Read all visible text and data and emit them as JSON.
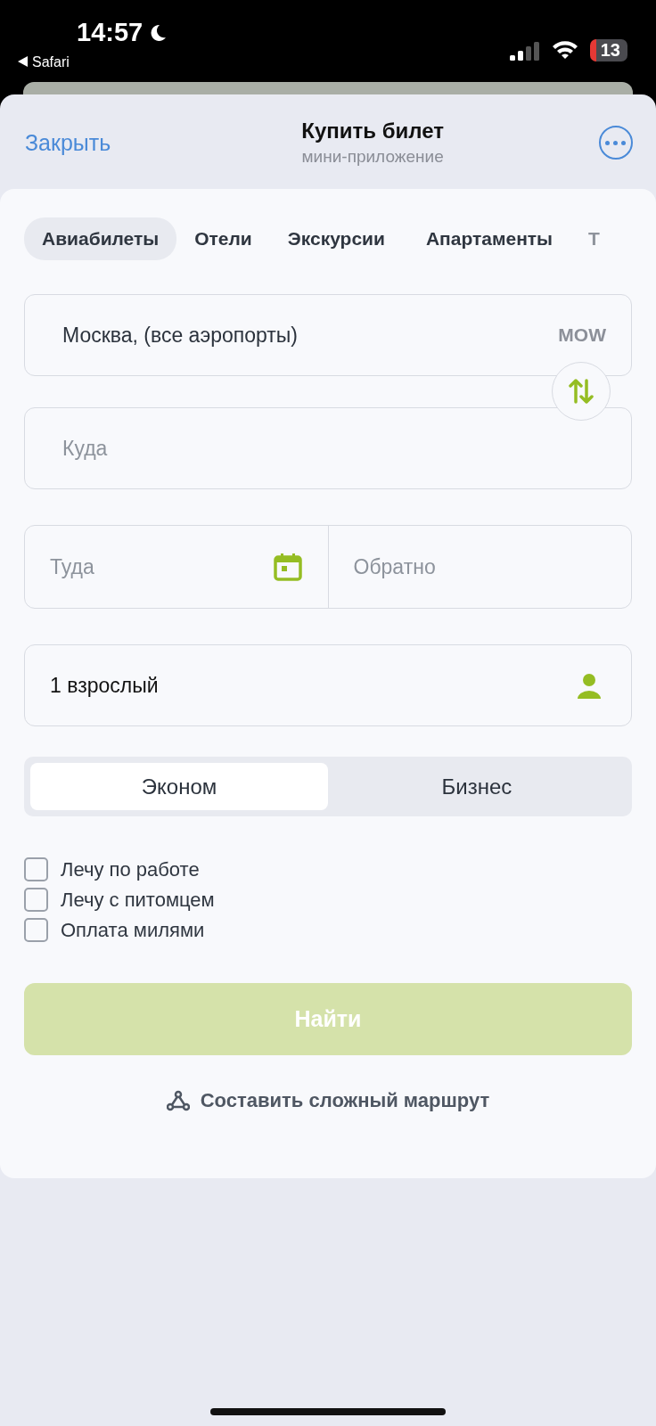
{
  "status_bar": {
    "time": "14:57",
    "back_app": "Safari",
    "battery": "13"
  },
  "header": {
    "close": "Закрыть",
    "title": "Купить билет",
    "subtitle": "мини-приложение"
  },
  "tabs": [
    {
      "label": "Авиабилеты",
      "selected": true
    },
    {
      "label": "Отели",
      "selected": false
    },
    {
      "label": "Экскурсии",
      "selected": false
    },
    {
      "label": "Апартаменты",
      "selected": false
    },
    {
      "label": "Т",
      "selected": false
    }
  ],
  "from": {
    "value": "Москва, (все аэропорты)",
    "code": "MOW"
  },
  "to": {
    "placeholder": "Куда"
  },
  "dates": {
    "depart_placeholder": "Туда",
    "return_placeholder": "Обратно"
  },
  "passengers": {
    "value": "1 взрослый"
  },
  "travel_class": [
    {
      "label": "Эконом",
      "selected": true
    },
    {
      "label": "Бизнес",
      "selected": false
    }
  ],
  "options": [
    {
      "label": "Лечу по работе",
      "checked": false
    },
    {
      "label": "Лечу с питомцем",
      "checked": false
    },
    {
      "label": "Оплата милями",
      "checked": false
    }
  ],
  "search_button": {
    "label": "Найти",
    "disabled": true
  },
  "route_link": "Составить сложный маршрут"
}
